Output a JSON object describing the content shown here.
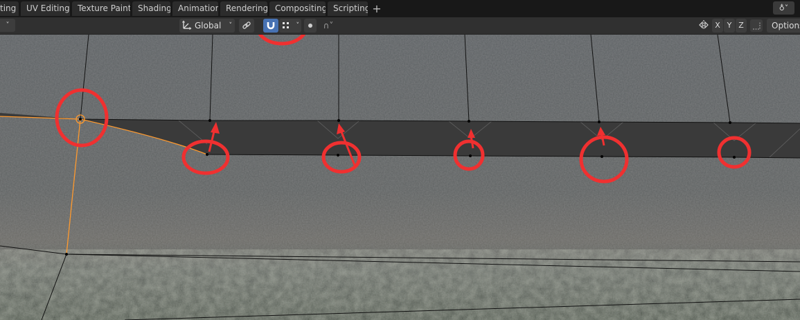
{
  "tabs": [
    {
      "label": "ting"
    },
    {
      "label": "UV Editing"
    },
    {
      "label": "Texture Paint"
    },
    {
      "label": "Shading"
    },
    {
      "label": "Animation"
    },
    {
      "label": "Rendering"
    },
    {
      "label": "Compositing"
    },
    {
      "label": "Scripting"
    }
  ],
  "tab_add_label": "+",
  "scene_widget_label": "♁˅",
  "header": {
    "dropdown_stub": "˅",
    "orientation_icon": "transform-orientation-icon",
    "orientation_label": "Global",
    "dropdown_chevron": "˅",
    "pivot_icon": "link-icon",
    "snap_icon": "magnet-icon",
    "snap_element_icon": "snap-vertex-icon",
    "proportional_icon": "proportional-edit-icon",
    "falloff_label": "∩˅",
    "mirror_icon": "mirror-icon",
    "axis_x": "X",
    "axis_y": "Y",
    "axis_z": "Z",
    "options_label": "Options"
  },
  "colors": {
    "ui_bg": "#303030",
    "tab_bg": "#2c2c2c",
    "active_button": "#4772b3",
    "mesh_face": "#3a3a3a",
    "selection_orange": "#ff9a2e",
    "annotation_red": "#f03030"
  }
}
